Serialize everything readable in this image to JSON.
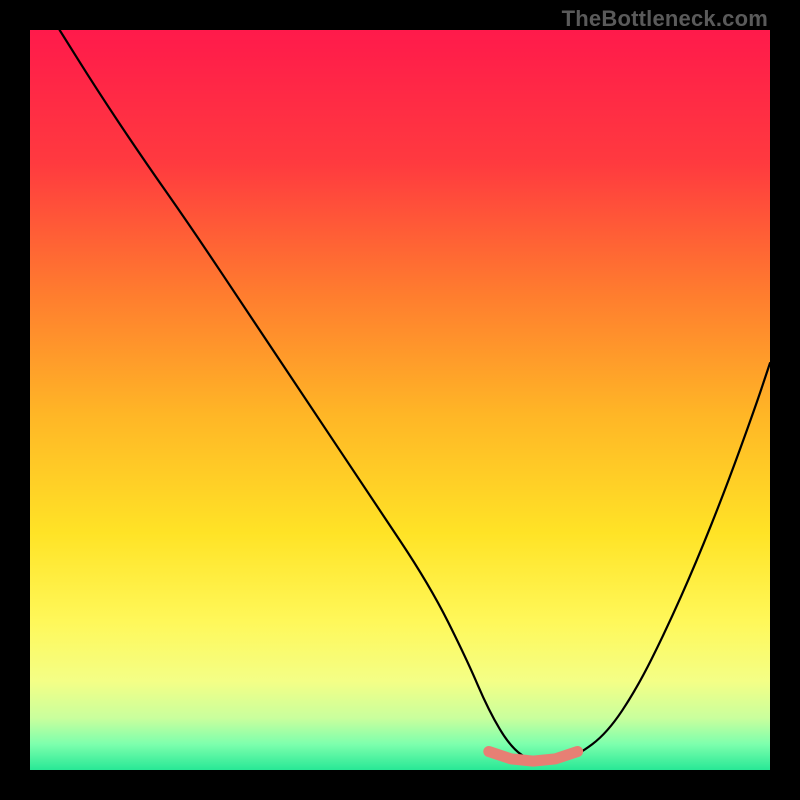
{
  "watermark": "TheBottleneck.com",
  "chart_data": {
    "type": "line",
    "title": "",
    "xlabel": "",
    "ylabel": "",
    "xlim": [
      0,
      100
    ],
    "ylim": [
      0,
      100
    ],
    "series": [
      {
        "name": "bottleneck-curve",
        "x": [
          4,
          9,
          15,
          22,
          30,
          38,
          46,
          54,
          59,
          62,
          65,
          68,
          71,
          74,
          78,
          82,
          86,
          90,
          94,
          98,
          100
        ],
        "y": [
          100,
          92,
          83,
          73,
          61,
          49,
          37,
          25,
          15,
          8,
          3,
          1,
          1,
          2,
          5,
          11,
          19,
          28,
          38,
          49,
          55
        ]
      },
      {
        "name": "optimal-band",
        "x": [
          62,
          65,
          68,
          71,
          74
        ],
        "y": [
          2.5,
          1.5,
          1.2,
          1.5,
          2.5
        ]
      }
    ],
    "background_gradient": {
      "stops": [
        {
          "pos": 0.0,
          "color": "#ff1a4b"
        },
        {
          "pos": 0.18,
          "color": "#ff3a3f"
        },
        {
          "pos": 0.35,
          "color": "#ff7a2f"
        },
        {
          "pos": 0.52,
          "color": "#ffb626"
        },
        {
          "pos": 0.68,
          "color": "#ffe326"
        },
        {
          "pos": 0.8,
          "color": "#fff85a"
        },
        {
          "pos": 0.88,
          "color": "#f4ff86"
        },
        {
          "pos": 0.93,
          "color": "#c9ff9d"
        },
        {
          "pos": 0.965,
          "color": "#7dffad"
        },
        {
          "pos": 1.0,
          "color": "#28e896"
        }
      ]
    },
    "accent_colors": {
      "curve": "#000000",
      "optimal_band": "#e77f74"
    }
  }
}
